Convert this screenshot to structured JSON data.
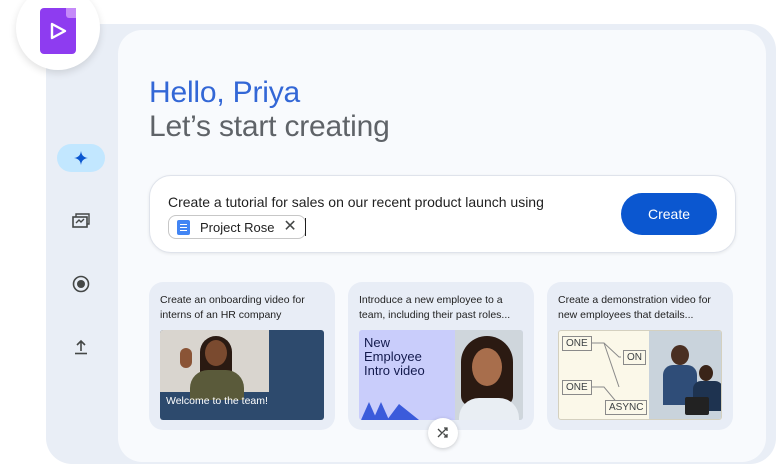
{
  "app": {
    "logo_icon": "video-play-icon"
  },
  "rail": [
    {
      "icon": "sparkle-icon",
      "active": true
    },
    {
      "icon": "media-library-icon",
      "active": false
    },
    {
      "icon": "record-icon",
      "active": false
    },
    {
      "icon": "upload-icon",
      "active": false
    }
  ],
  "greeting": "Hello, Priya",
  "subheading": "Let’s start creating",
  "prompt": {
    "text": "Create a tutorial for sales on our recent product launch using",
    "chip_label": "Project Rose",
    "chip_icon": "docs-icon",
    "create_label": "Create"
  },
  "cards": [
    {
      "caption": "Create an onboarding video for interns of an HR company",
      "thumb_label": "Welcome to the team!"
    },
    {
      "caption": "Introduce a new employee to a team, including their past roles...",
      "thumb_title": "New Employee Intro video"
    },
    {
      "caption": "Create a demonstration video for new employees that details...",
      "diagram_labels": [
        "ONE",
        "ON",
        "ONE",
        "ASYNC"
      ]
    }
  ],
  "shuffle_icon": "shuffle-icon",
  "colors": {
    "accent": "#0b57d0",
    "greeting": "#3367d6",
    "rail_active": "#c2e7ff"
  }
}
